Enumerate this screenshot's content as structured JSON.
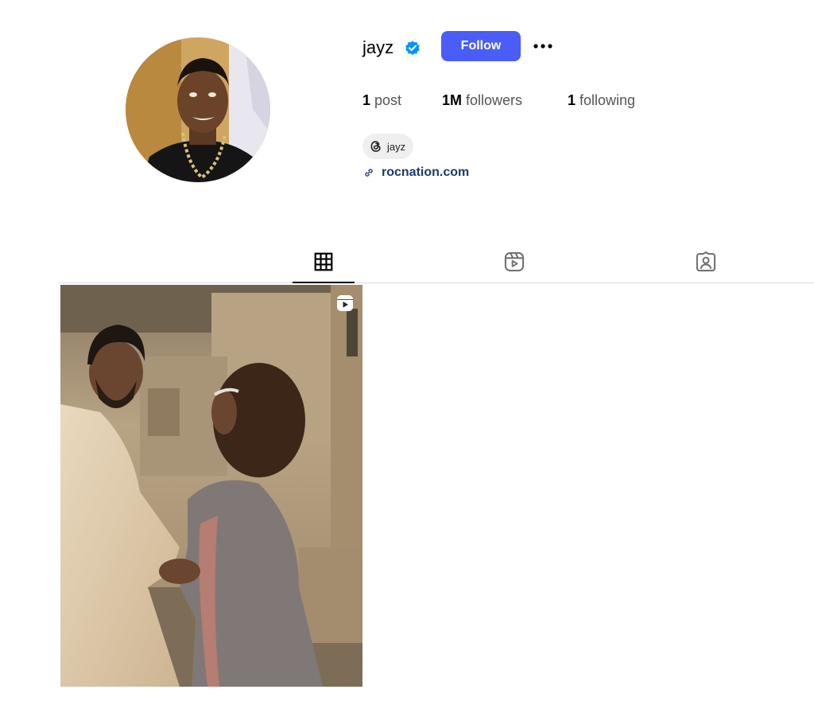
{
  "profile": {
    "username": "jayz",
    "verified": true,
    "follow_label": "Follow",
    "more_label": "•••",
    "stats": {
      "posts_count": "1",
      "posts_label": "post",
      "followers_count": "1M",
      "followers_label": "followers",
      "following_count": "1",
      "following_label": "following"
    },
    "threads_handle": "jayz",
    "website": "rocnation.com"
  },
  "tabs": [
    {
      "id": "posts",
      "icon": "grid-icon",
      "active": true
    },
    {
      "id": "reels",
      "icon": "reels-icon",
      "active": false
    },
    {
      "id": "tagged",
      "icon": "tagged-icon",
      "active": false
    }
  ],
  "posts": [
    {
      "type": "reel",
      "icon": "reel-play-icon"
    }
  ],
  "colors": {
    "accent": "#4a5df9",
    "verified": "#0095f6",
    "link": "#1a3a6e",
    "divider": "#dbdbdb"
  }
}
